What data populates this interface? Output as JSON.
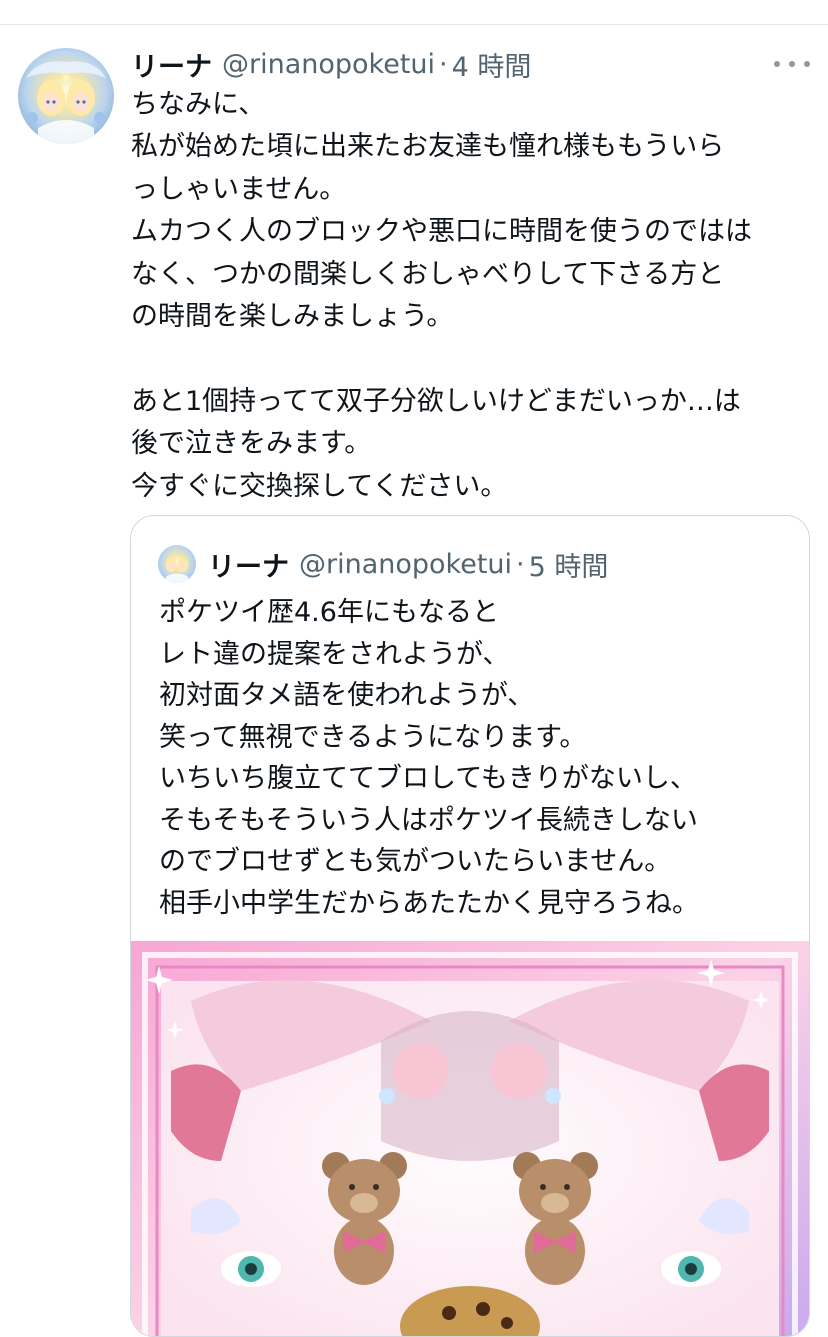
{
  "tweet": {
    "author_name": "リーナ",
    "handle": "@rinanopoketui",
    "separator": "·",
    "time": "4 時間",
    "lines": [
      "ちなみに、",
      "私が始めた頃に出来たお友達も憧れ様ももういら",
      "っしゃいません。",
      "ムカつく人のブロックや悪口に時間を使うのではは",
      "なく、つかの間楽しくおしゃべりして下さる方と",
      "の時間を楽しみましょう。",
      "",
      "あと1個持ってて双子分欲しいけどまだいっか…は",
      "後で泣きをみます。",
      "今すぐに交換探してください。"
    ]
  },
  "quoted": {
    "author_name": "リーナ",
    "handle": "@rinanopoketui",
    "separator": "·",
    "time": "5 時間",
    "lines": [
      "ポケツイ歴4.6年にもなると",
      "レト違の提案をされようが、",
      "初対面タメ語を使われようが、",
      "笑って無視できるようになります。",
      "いちいち腹立ててブロしてもきりがないし、",
      "そもそもそういう人はポケツイ長続きしない",
      "のでブロせずとも気がついたらいません。",
      "相手小中学生だからあたたかく見守ろうね。"
    ]
  },
  "icons": {
    "more": "more-horizontal-icon"
  },
  "colors": {
    "text": "#0f1419",
    "secondary": "#536471",
    "border": "#cfd9de",
    "image_pink": "#f48cc8"
  }
}
